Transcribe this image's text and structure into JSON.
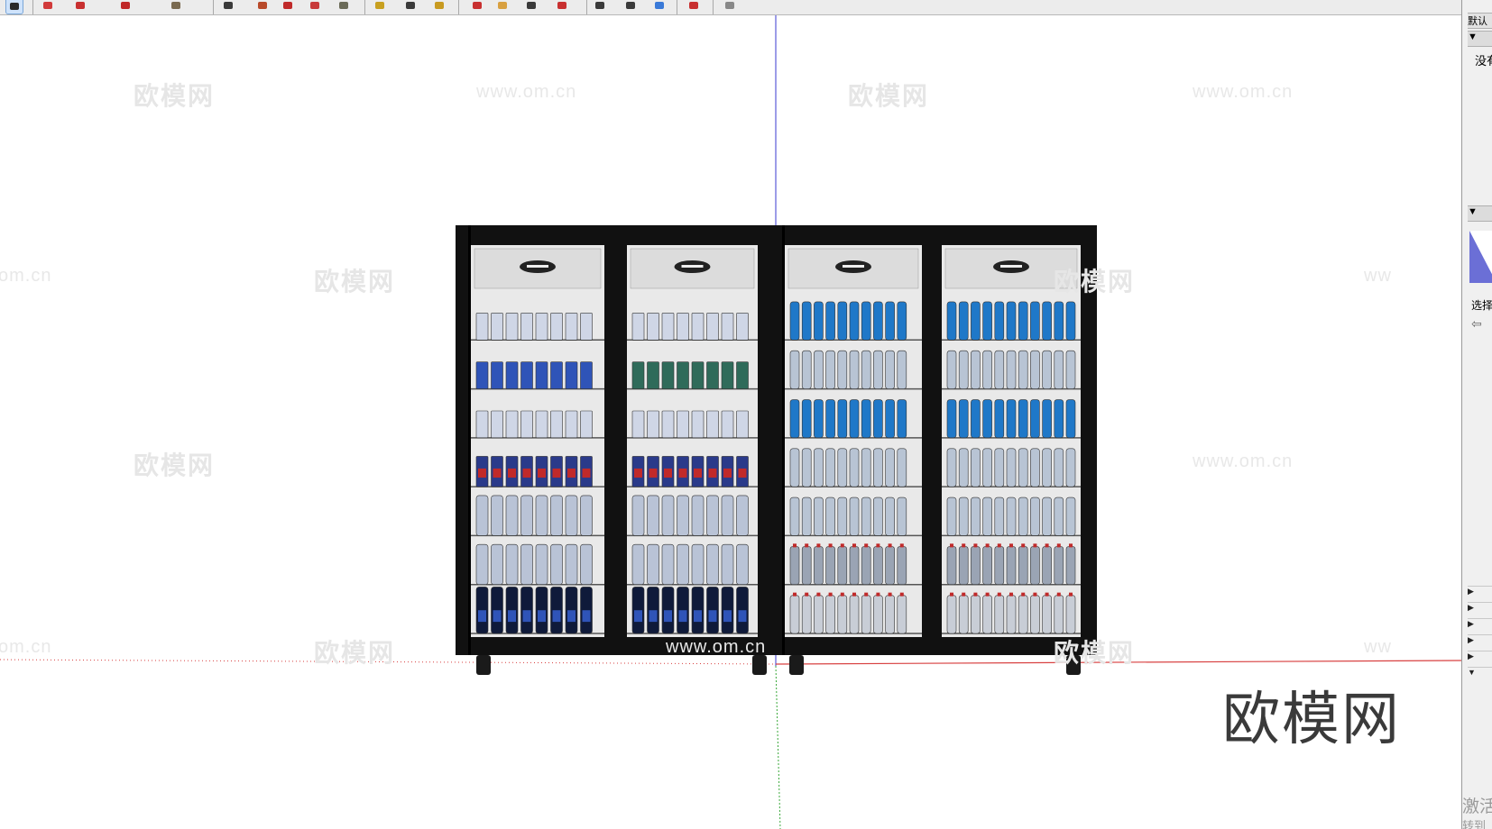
{
  "toolbar": {
    "icons": [
      "select-arrow-icon",
      "eraser-icon",
      "pencil-icon",
      "line-icon",
      "paint-bucket-icon",
      "push-pull-icon",
      "follow-me-icon",
      "move-icon",
      "rotate-icon",
      "scale-icon",
      "tape-measure-icon",
      "dimension-icon",
      "protractor-icon",
      "orbit-icon",
      "pan-icon",
      "zoom-icon",
      "zoom-extents-icon",
      "previous-view-icon",
      "next-view-icon",
      "walk-icon",
      "position-camera-icon",
      "section-plane-icon",
      "extension-warehouse-icon"
    ]
  },
  "viewport": {
    "watermarks": [
      "欧模网",
      "www.om.cn",
      "欧模网",
      "www.om.cn",
      "om.cn",
      "欧模网",
      "欧模网",
      "ww",
      "欧模网",
      "www.om.cn",
      "om.cn",
      "欧模网",
      "www.om.cn",
      "欧模网",
      "ww"
    ],
    "brand": "欧模网",
    "model": {
      "name": "beverage-display-fridge",
      "doors": 4,
      "shelves_per_door": 7
    },
    "colors": {
      "cabinet": "#111111",
      "interior": "#e9e9e9",
      "blue_axis": "#5a5ad8",
      "red_axis": "#d84040",
      "green_axis": "#3aa83a",
      "can_blue": "#2f54b8",
      "water_blue": "#1f78c8",
      "soda_red": "#c02a2a"
    }
  },
  "tray": {
    "header_top": "默认",
    "header_row": "▼ ",
    "text_1": "没有",
    "header_mid": "▼ ",
    "text_2": "选择",
    "rows": [
      "▶ ",
      "▶ ",
      "▶ ",
      "▶ ",
      "▶ ",
      "▼ "
    ],
    "activate_1": "激活",
    "activate_2": "转到"
  }
}
